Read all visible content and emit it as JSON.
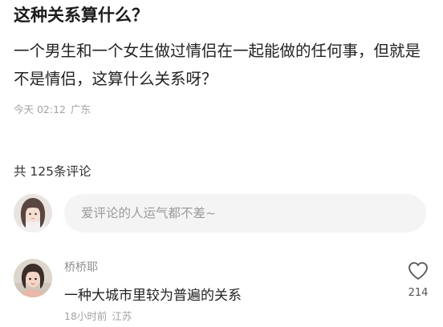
{
  "post": {
    "title": "这种关系算什么？",
    "body": "一个男生和一个女生做过情侣在一起能做的任何事，但就是不是情侣，这算什么关系呀？",
    "time": "今天 02:12",
    "location": "广东"
  },
  "comments": {
    "count_label": "共 125条评论",
    "input": {
      "placeholder": "爱评论的人运气都不差~"
    },
    "items": [
      {
        "author": "桥桥耶",
        "text": "一种大城市里较为普遍的关系",
        "time": "18小时前",
        "location": "江苏",
        "likes": "214",
        "like_icon": "heart-outline-icon"
      }
    ]
  },
  "colors": {
    "text_primary": "#222222",
    "text_secondary": "#a3a3a3",
    "input_bg": "#f4f4f4"
  }
}
